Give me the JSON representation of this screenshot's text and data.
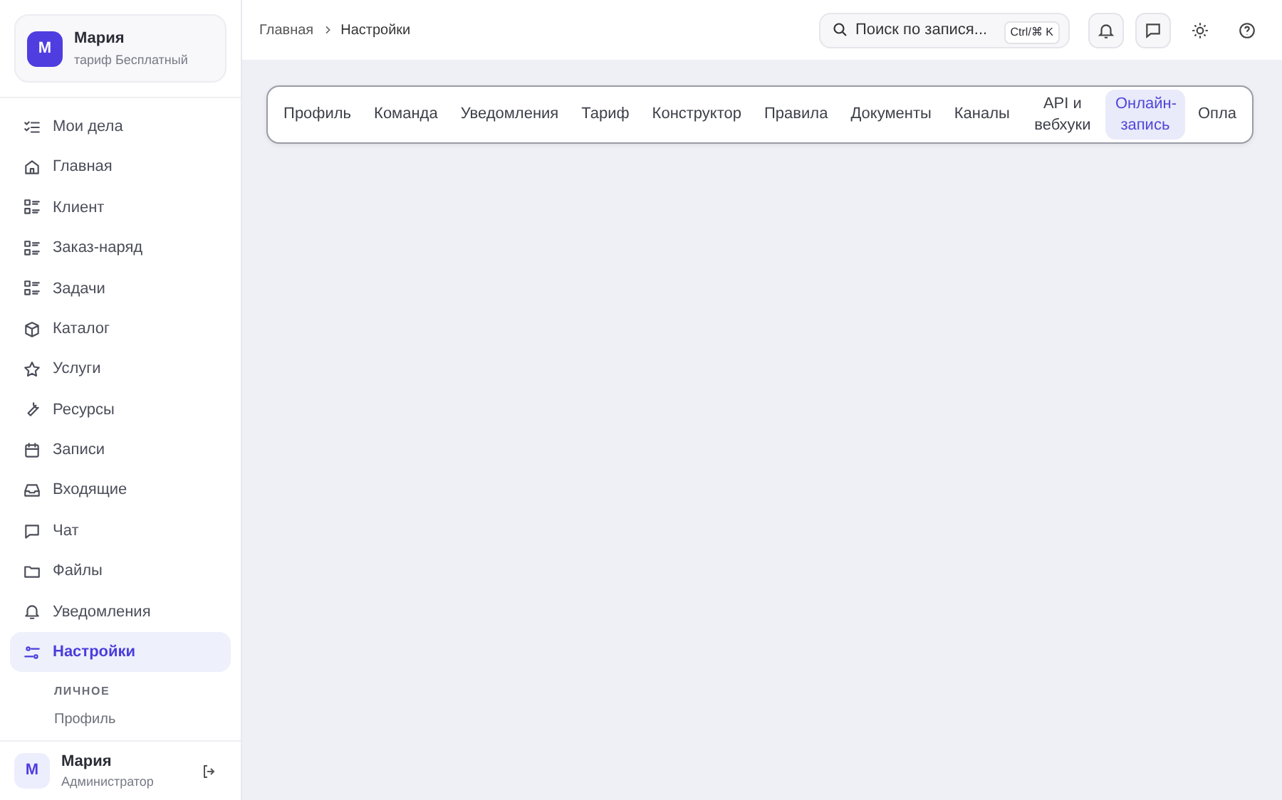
{
  "account": {
    "avatar": "М",
    "name": "Мария",
    "plan": "тариф Бесплатный"
  },
  "sidebar": {
    "items": [
      {
        "label": "Мои дела",
        "selected": false
      },
      {
        "label": "Главная",
        "selected": false
      },
      {
        "label": "Клиент",
        "selected": false
      },
      {
        "label": "Заказ-наряд",
        "selected": false
      },
      {
        "label": "Задачи",
        "selected": false
      },
      {
        "label": "Каталог",
        "selected": false
      },
      {
        "label": "Услуги",
        "selected": false
      },
      {
        "label": "Ресурсы",
        "selected": false
      },
      {
        "label": "Записи",
        "selected": false
      },
      {
        "label": "Входящие",
        "selected": false
      },
      {
        "label": "Чат",
        "selected": false
      },
      {
        "label": "Файлы",
        "selected": false
      },
      {
        "label": "Уведомления",
        "selected": false
      },
      {
        "label": "Настройки",
        "selected": true
      }
    ],
    "section_heading": "ЛИЧНОЕ",
    "sub_item": "Профиль"
  },
  "user": {
    "avatar": "М",
    "name": "Мария",
    "role": "Администратор"
  },
  "breadcrumbs": [
    "Главная",
    "Настройки"
  ],
  "search": {
    "placeholder": "Поиск по запися...",
    "shortcut": "Ctrl/⌘ K"
  },
  "tabs": [
    {
      "label": "Профиль",
      "selected": false
    },
    {
      "label": "Команда",
      "selected": false
    },
    {
      "label": "Уведомления",
      "selected": false
    },
    {
      "label": "Тариф",
      "selected": false
    },
    {
      "label": "Конструктор",
      "selected": false
    },
    {
      "label": "Правила",
      "selected": false
    },
    {
      "label": "Документы",
      "selected": false
    },
    {
      "label": "Каналы",
      "selected": false
    },
    {
      "label": "API и вебхуки",
      "selected": false
    },
    {
      "label": "Онлайн-запись",
      "selected": true
    },
    {
      "label": "Опла",
      "selected": false
    }
  ]
}
